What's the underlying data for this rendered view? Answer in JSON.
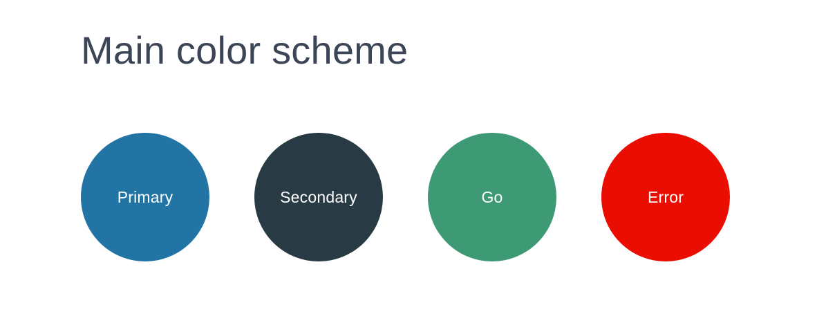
{
  "page": {
    "title": "Main color scheme",
    "title_color": "#3b4556",
    "background": "#ffffff"
  },
  "swatches": [
    {
      "label": "Primary",
      "color": "#2274a5"
    },
    {
      "label": "Secondary",
      "color": "#283b44"
    },
    {
      "label": "Go",
      "color": "#3e9a74"
    },
    {
      "label": "Error",
      "color": "#e90e01"
    }
  ]
}
